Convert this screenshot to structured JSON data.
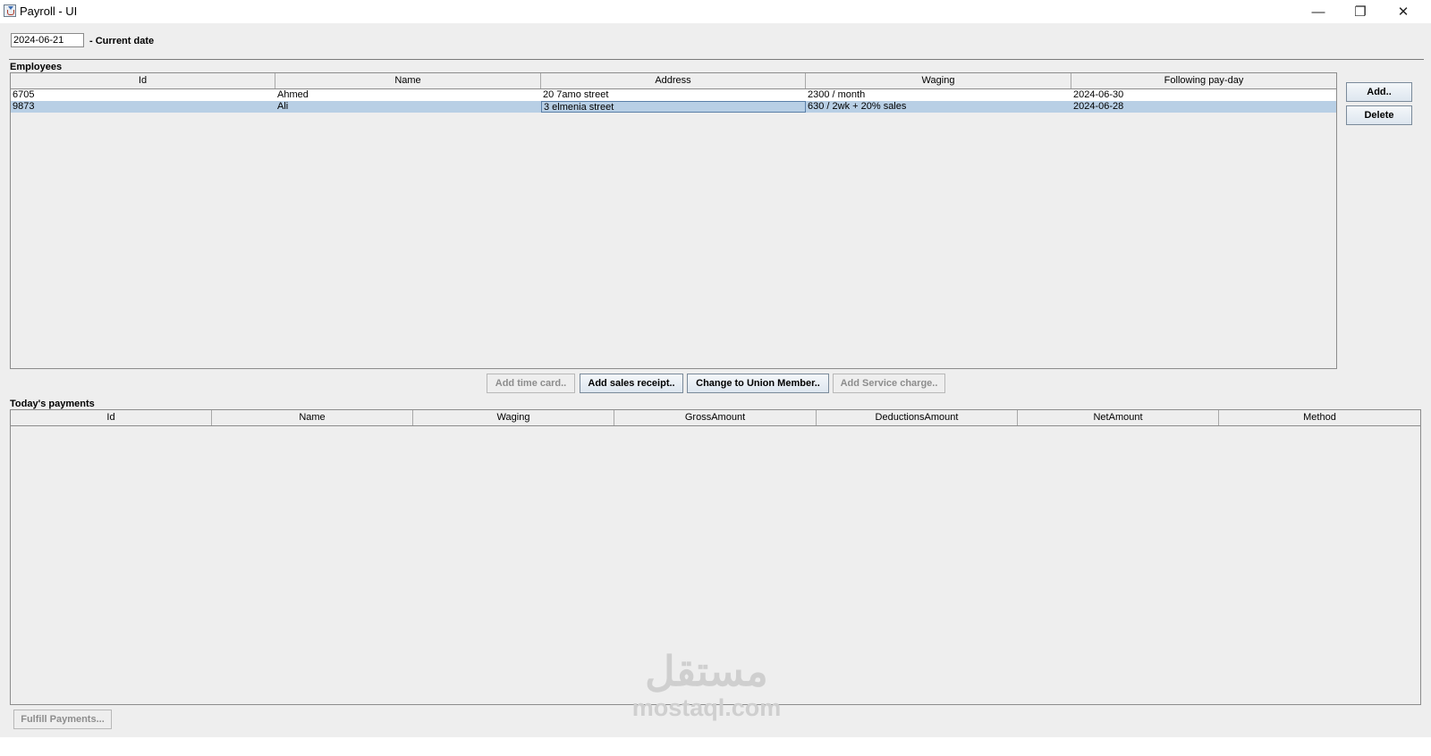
{
  "window": {
    "title": "Payroll - UI",
    "minimize_glyph": "—",
    "maximize_glyph": "❐",
    "close_glyph": "✕"
  },
  "date": {
    "value": "2024-06-21",
    "label": "- Current date"
  },
  "employees": {
    "section_label": "Employees",
    "columns": [
      "Id",
      "Name",
      "Address",
      "Waging",
      "Following pay-day"
    ],
    "rows": [
      {
        "id": "6705",
        "name": "Ahmed",
        "address": "20 7amo street",
        "waging": "2300 / month",
        "payday": "2024-06-30",
        "selected": false
      },
      {
        "id": "9873",
        "name": "Ali",
        "address": "3 elmenia street",
        "waging": "630 / 2wk + 20% sales",
        "payday": "2024-06-28",
        "selected": true
      }
    ],
    "add_button": "Add..",
    "delete_button": "Delete"
  },
  "actions": {
    "add_time_card": "Add time card..",
    "add_sales_receipt": "Add sales receipt..",
    "change_union": "Change to Union Member..",
    "add_service_charge": "Add Service charge.."
  },
  "payments": {
    "section_label": "Today's payments",
    "columns": [
      "Id",
      "Name",
      "Waging",
      "GrossAmount",
      "DeductionsAmount",
      "NetAmount",
      "Method"
    ],
    "fulfill_button": "Fulfill Payments..."
  },
  "watermark": {
    "arabic": "مستقل",
    "site": "mostaql.com"
  },
  "colors": {
    "window_bg": "#eeeeee",
    "selection": "#b8cfe5",
    "button_border": "#7a8a9a"
  }
}
